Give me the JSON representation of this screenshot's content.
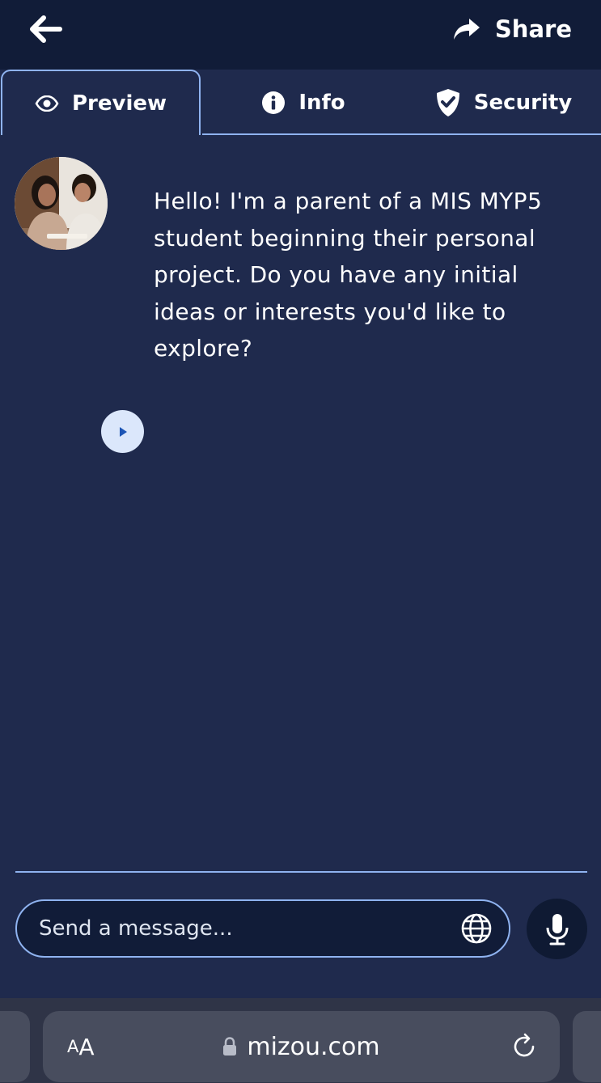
{
  "header": {
    "back_icon": "arrow-left-icon",
    "share_label": "Share",
    "share_icon": "share-arrow-icon"
  },
  "tabs": [
    {
      "label": "Preview",
      "icon": "eye-icon",
      "active": true
    },
    {
      "label": "Info",
      "icon": "info-icon",
      "active": false
    },
    {
      "label": "Security",
      "icon": "shield-check-icon",
      "active": false
    }
  ],
  "chat": {
    "message": "Hello! I'm a parent of a MIS MYP5 student beginning their personal project. Do you have any initial ideas or interests you'd like to explore?",
    "play_icon": "play-icon"
  },
  "composer": {
    "placeholder": "Send a message...",
    "globe_icon": "globe-icon",
    "mic_icon": "microphone-icon"
  },
  "browser": {
    "aa_small": "A",
    "aa_big": "A",
    "url": "mizou.com",
    "lock_icon": "lock-icon",
    "reload_icon": "reload-icon"
  },
  "colors": {
    "background": "#1f2a4d",
    "topbar": "#111c38",
    "accent_border": "#8fb3f0"
  }
}
